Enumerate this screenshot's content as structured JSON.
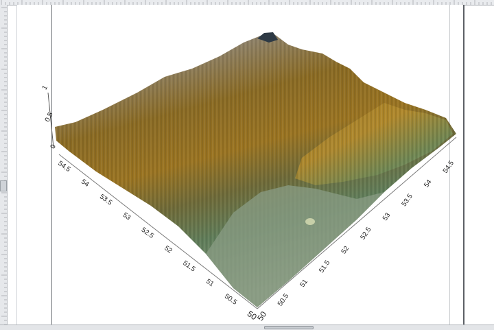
{
  "window": {
    "scroll_thumb_label": "",
    "colors": {
      "background": "#ffffff",
      "ruler": "#e9ebee",
      "frame_line": "#5c6065",
      "terrain_high": "#b8a980",
      "terrain_mid": "#8c6a1e",
      "terrain_low": "#5e7f5a",
      "terrain_valley": "#8fa087"
    }
  },
  "plot": {
    "z_axis_ticks": [
      "0",
      "0.5",
      "1"
    ],
    "left_axis_ticks": [
      "54.5",
      "54",
      "53.5",
      "53",
      "52.5",
      "52",
      "51.5",
      "51",
      "50.5",
      "50"
    ],
    "right_axis_ticks": [
      "50",
      "50.5",
      "51",
      "51.5",
      "52",
      "52.5",
      "53",
      "53.5",
      "54",
      "54.5"
    ]
  }
}
